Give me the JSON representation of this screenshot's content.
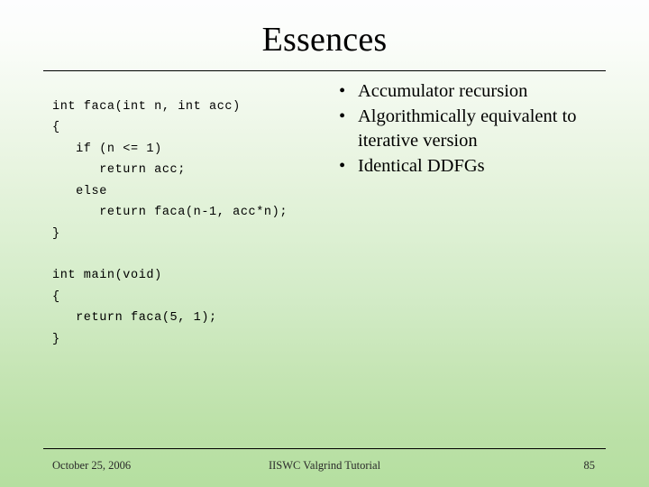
{
  "slide": {
    "title": "Essences",
    "page_number": "85",
    "background": {
      "top_color": "#fdfdfe",
      "bottom_color": "#b5dfa0"
    },
    "rule_color": "#000000"
  },
  "code_blocks": [
    {
      "name": "faca-function",
      "text": "int faca(int n, int acc)\n{\n   if (n <= 1)\n      return acc;\n   else\n      return faca(n-1, acc*n);\n}"
    },
    {
      "name": "main-function",
      "text": "int main(void)\n{\n   return faca(5, 1);\n}"
    }
  ],
  "bullets": [
    {
      "marker": "•",
      "text": "Accumulator recursion"
    },
    {
      "marker": "•",
      "text": "Algorithmically equivalent to iterative version"
    },
    {
      "marker": "•",
      "text": "Identical DDFGs"
    }
  ],
  "footer": {
    "date": "October 25, 2006",
    "center": "IISWC Valgrind Tutorial",
    "page": "85"
  }
}
